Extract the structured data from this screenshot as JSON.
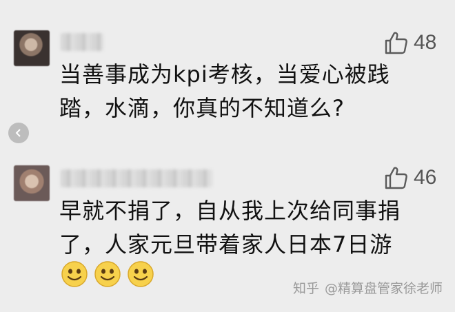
{
  "comments": [
    {
      "likes": "48",
      "text": "当善事成为kpi考核，当爱心被践\n踏，水滴，你真的不知道么?"
    },
    {
      "likes": "46",
      "text": "早就不捐了，自从我上次给同事捐\n了，人家元旦带着家人日本7日游"
    }
  ],
  "emoji_count": 3,
  "watermark": {
    "site": "知乎",
    "author": "@精算盘管家徐老师"
  },
  "icons": {
    "like": "thumbs-up-icon",
    "back": "chevron-left-icon",
    "emoji": "smile-emoji-icon"
  }
}
